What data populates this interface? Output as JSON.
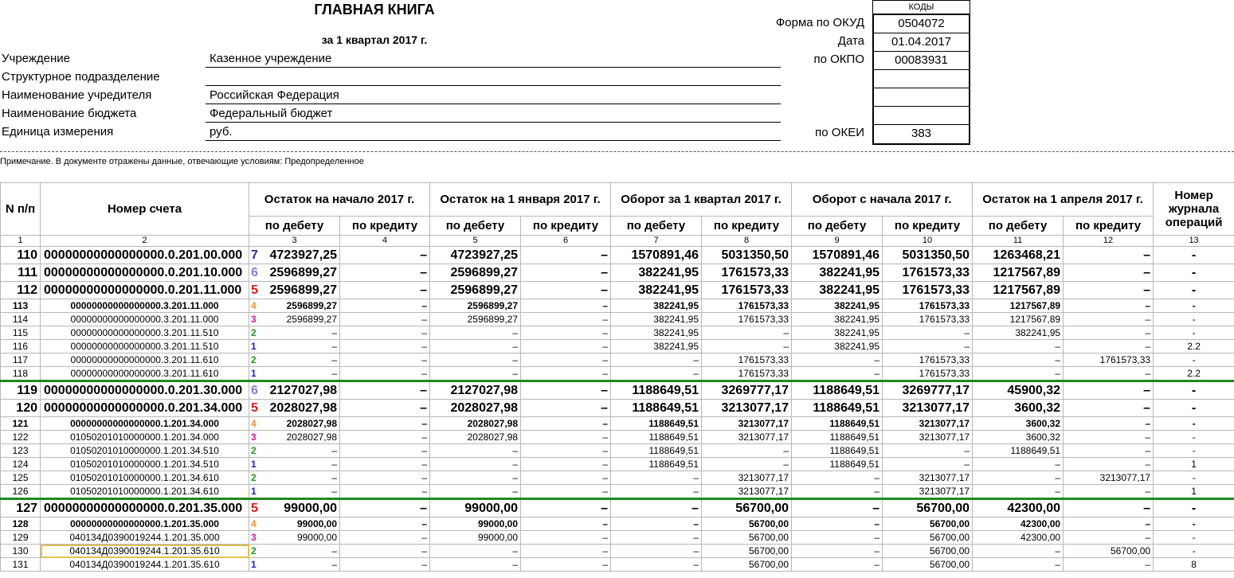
{
  "header": {
    "title": "ГЛАВНАЯ КНИГА",
    "period": "за 1 квартал 2017 г.",
    "fields": [
      {
        "label": "Учреждение",
        "value": "Казенное учреждение"
      },
      {
        "label": "Структурное подразделение",
        "value": ""
      },
      {
        "label": "Наименование учредителя",
        "value": "Российская Федерация"
      },
      {
        "label": "Наименование бюджета",
        "value": "Федеральный бюджет"
      },
      {
        "label": "Единица измерения",
        "value": "руб."
      }
    ],
    "codes_title": "КОДЫ",
    "codes": [
      {
        "label": "Форма по ОКУД",
        "value": "0504072"
      },
      {
        "label": "Дата",
        "value": "01.04.2017"
      },
      {
        "label": "по ОКПО",
        "value": "00083931"
      },
      {
        "label": "",
        "value": ""
      },
      {
        "label": "",
        "value": ""
      },
      {
        "label": "",
        "value": ""
      },
      {
        "label": "по ОКЕИ",
        "value": "383"
      }
    ],
    "note": "Примечание. В документе отражены данные, отвечающие условиям: Предопределенное"
  },
  "table": {
    "headers": {
      "n": "N п/п",
      "account": "Номер счета",
      "groups": [
        "Остаток на начало 2017 г.",
        "Остаток на 1 января 2017 г.",
        "Оборот за 1 квартал 2017 г.",
        "Оборот с начала 2017 г.",
        "Остаток на 1 апреля 2017 г."
      ],
      "debit": "по дебету",
      "credit": "по кредиту",
      "journal": "Номер журнала операций",
      "col_numbers": [
        "1",
        "2",
        "3",
        "4",
        "5",
        "6",
        "7",
        "8",
        "9",
        "10",
        "11",
        "12",
        "13"
      ]
    },
    "level_colors": {
      "1": "#1a1ae6",
      "2": "#1a9a1a",
      "3": "#d4199a",
      "4": "#f0902a",
      "5": "#e01818",
      "6": "#7f7fe6",
      "7": "#2a2aa8"
    },
    "rows": [
      {
        "n": "110",
        "acc": "00000000000000000.0.201.00.000",
        "lvl": "7",
        "v": [
          "4723927,25",
          "–",
          "4723927,25",
          "–",
          "1570891,46",
          "5031350,50",
          "1570891,46",
          "5031350,50",
          "1263468,21",
          "–"
        ],
        "jr": "-",
        "style": "main"
      },
      {
        "n": "111",
        "acc": "00000000000000000.0.201.10.000",
        "lvl": "6",
        "v": [
          "2596899,27",
          "–",
          "2596899,27",
          "–",
          "382241,95",
          "1761573,33",
          "382241,95",
          "1761573,33",
          "1217567,89",
          "–"
        ],
        "jr": "-",
        "style": "main"
      },
      {
        "n": "112",
        "acc": "00000000000000000.0.201.11.000",
        "lvl": "5",
        "v": [
          "2596899,27",
          "–",
          "2596899,27",
          "–",
          "382241,95",
          "1761573,33",
          "382241,95",
          "1761573,33",
          "1217567,89",
          "–"
        ],
        "jr": "-",
        "style": "main"
      },
      {
        "n": "113",
        "acc": "00000000000000000.3.201.11.000",
        "lvl": "4",
        "v": [
          "2596899,27",
          "–",
          "2596899,27",
          "–",
          "382241,95",
          "1761573,33",
          "382241,95",
          "1761573,33",
          "1217567,89",
          "–"
        ],
        "jr": "-",
        "style": "bold"
      },
      {
        "n": "114",
        "acc": "00000000000000000.3.201.11.000",
        "lvl": "3",
        "v": [
          "2596899,27",
          "–",
          "2596899,27",
          "–",
          "382241,95",
          "1761573,33",
          "382241,95",
          "1761573,33",
          "1217567,89",
          "–"
        ],
        "jr": "-",
        "style": "normal"
      },
      {
        "n": "115",
        "acc": "00000000000000000.3.201.11.510",
        "lvl": "2",
        "v": [
          "–",
          "–",
          "–",
          "–",
          "382241,95",
          "–",
          "382241,95",
          "–",
          "382241,95",
          "–"
        ],
        "jr": "-",
        "style": "normal"
      },
      {
        "n": "116",
        "acc": "00000000000000000.3.201.11.510",
        "lvl": "1",
        "v": [
          "–",
          "–",
          "–",
          "–",
          "382241,95",
          "–",
          "382241,95",
          "–",
          "–",
          "–"
        ],
        "jr": "2.2",
        "style": "normal"
      },
      {
        "n": "117",
        "acc": "00000000000000000.3.201.11.610",
        "lvl": "2",
        "v": [
          "–",
          "–",
          "–",
          "–",
          "–",
          "1761573,33",
          "–",
          "1761573,33",
          "–",
          "1761573,33"
        ],
        "jr": "-",
        "style": "normal"
      },
      {
        "n": "118",
        "acc": "00000000000000000.3.201.11.610",
        "lvl": "1",
        "v": [
          "–",
          "–",
          "–",
          "–",
          "–",
          "1761573,33",
          "–",
          "1761573,33",
          "–",
          "–"
        ],
        "jr": "2.2",
        "style": "normal"
      },
      {
        "n": "119",
        "acc": "00000000000000000.0.201.30.000",
        "lvl": "6",
        "v": [
          "2127027,98",
          "–",
          "2127027,98",
          "–",
          "1188649,51",
          "3269777,17",
          "1188649,51",
          "3269777,17",
          "45900,32",
          "–"
        ],
        "jr": "-",
        "style": "main",
        "green": true
      },
      {
        "n": "120",
        "acc": "00000000000000000.0.201.34.000",
        "lvl": "5",
        "v": [
          "2028027,98",
          "–",
          "2028027,98",
          "–",
          "1188649,51",
          "3213077,17",
          "1188649,51",
          "3213077,17",
          "3600,32",
          "–"
        ],
        "jr": "-",
        "style": "main"
      },
      {
        "n": "121",
        "acc": "00000000000000000.1.201.34.000",
        "lvl": "4",
        "v": [
          "2028027,98",
          "–",
          "2028027,98",
          "–",
          "1188649,51",
          "3213077,17",
          "1188649,51",
          "3213077,17",
          "3600,32",
          "–"
        ],
        "jr": "-",
        "style": "bold"
      },
      {
        "n": "122",
        "acc": "01050201010000000.1.201.34.000",
        "lvl": "3",
        "v": [
          "2028027,98",
          "–",
          "2028027,98",
          "–",
          "1188649,51",
          "3213077,17",
          "1188649,51",
          "3213077,17",
          "3600,32",
          "–"
        ],
        "jr": "-",
        "style": "normal"
      },
      {
        "n": "123",
        "acc": "01050201010000000.1.201.34.510",
        "lvl": "2",
        "v": [
          "–",
          "–",
          "–",
          "–",
          "1188649,51",
          "–",
          "1188649,51",
          "–",
          "1188649,51",
          "–"
        ],
        "jr": "-",
        "style": "normal"
      },
      {
        "n": "124",
        "acc": "01050201010000000.1.201.34.510",
        "lvl": "1",
        "v": [
          "–",
          "–",
          "–",
          "–",
          "1188649,51",
          "–",
          "1188649,51",
          "–",
          "–",
          "–"
        ],
        "jr": "1",
        "style": "normal"
      },
      {
        "n": "125",
        "acc": "01050201010000000.1.201.34.610",
        "lvl": "2",
        "v": [
          "–",
          "–",
          "–",
          "–",
          "–",
          "3213077,17",
          "–",
          "3213077,17",
          "–",
          "3213077,17"
        ],
        "jr": "-",
        "style": "normal"
      },
      {
        "n": "126",
        "acc": "01050201010000000.1.201.34.610",
        "lvl": "1",
        "v": [
          "–",
          "–",
          "–",
          "–",
          "–",
          "3213077,17",
          "–",
          "3213077,17",
          "–",
          "–"
        ],
        "jr": "1",
        "style": "normal"
      },
      {
        "n": "127",
        "acc": "00000000000000000.0.201.35.000",
        "lvl": "5",
        "v": [
          "99000,00",
          "–",
          "99000,00",
          "–",
          "–",
          "56700,00",
          "–",
          "56700,00",
          "42300,00",
          "–"
        ],
        "jr": "-",
        "style": "main",
        "green": true
      },
      {
        "n": "128",
        "acc": "00000000000000000.1.201.35.000",
        "lvl": "4",
        "v": [
          "99000,00",
          "–",
          "99000,00",
          "–",
          "–",
          "56700,00",
          "–",
          "56700,00",
          "42300,00",
          "–"
        ],
        "jr": "-",
        "style": "bold"
      },
      {
        "n": "129",
        "acc": "040134Д0390019244.1.201.35.000",
        "lvl": "3",
        "v": [
          "99000,00",
          "–",
          "99000,00",
          "–",
          "–",
          "56700,00",
          "–",
          "56700,00",
          "42300,00",
          "–"
        ],
        "jr": "-",
        "style": "normal"
      },
      {
        "n": "130",
        "acc": "040134Д0390019244.1.201.35.610",
        "lvl": "2",
        "v": [
          "–",
          "–",
          "–",
          "–",
          "–",
          "56700,00",
          "–",
          "56700,00",
          "–",
          "56700,00"
        ],
        "jr": "-",
        "style": "normal",
        "selected": true
      },
      {
        "n": "131",
        "acc": "040134Д0390019244.1.201.35.610",
        "lvl": "1",
        "v": [
          "–",
          "–",
          "–",
          "–",
          "–",
          "56700,00",
          "–",
          "56700,00",
          "–",
          "–"
        ],
        "jr": "8",
        "style": "normal"
      }
    ]
  }
}
